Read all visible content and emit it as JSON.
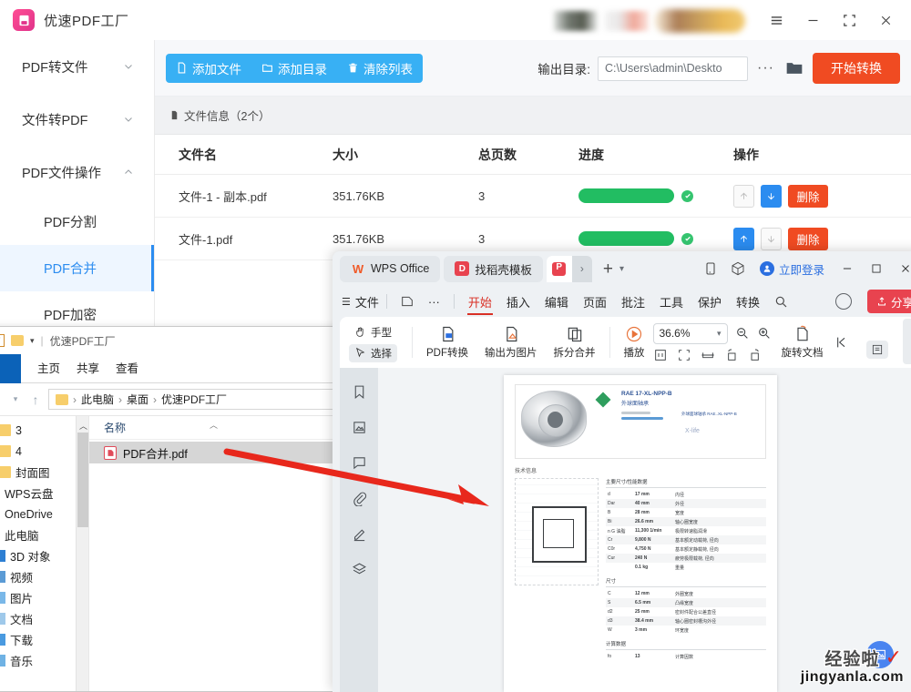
{
  "pdf_factory": {
    "app_title": "优速PDF工厂",
    "window_controls": [
      "menu-icon",
      "minimize-icon",
      "maximize-icon",
      "close-icon"
    ],
    "sidebar": {
      "groups": [
        {
          "label": "PDF转文件",
          "expanded": false
        },
        {
          "label": "文件转PDF",
          "expanded": false
        },
        {
          "label": "PDF文件操作",
          "expanded": true
        }
      ],
      "items": [
        {
          "label": "PDF分割",
          "active": false
        },
        {
          "label": "PDF合并",
          "active": true
        },
        {
          "label": "PDF加密",
          "active": false
        }
      ]
    },
    "toolbar": {
      "add_file": "添加文件",
      "add_folder": "添加目录",
      "clear_list": "清除列表",
      "output_label": "输出目录:",
      "output_path": "C:\\Users\\admin\\Deskto",
      "more_dots": "···",
      "convert_button": "开始转换"
    },
    "info_bar": "文件信息（2个）",
    "table": {
      "headers": [
        "文件名",
        "大小",
        "总页数",
        "进度",
        "操作"
      ],
      "rows": [
        {
          "name": "文件-1 - 副本.pdf",
          "size": "351.76KB",
          "pages": "3",
          "progress": 100,
          "status": "done",
          "up_enabled": false,
          "down_enabled": true,
          "delete_label": "删除"
        },
        {
          "name": "文件-1.pdf",
          "size": "351.76KB",
          "pages": "3",
          "progress": 100,
          "status": "done",
          "up_enabled": true,
          "down_enabled": false,
          "delete_label": "删除"
        }
      ]
    },
    "colors": {
      "accent_blue": "#38b0f4",
      "active_blue": "#2b8cf0",
      "convert_orange": "#f04b22",
      "progress_green": "#22bd62"
    }
  },
  "file_explorer": {
    "title": "优速PDF工厂",
    "ribbon_tabs": [
      "主页",
      "共享",
      "查看"
    ],
    "breadcrumb": [
      "此电脑",
      "桌面",
      "优速PDF工厂"
    ],
    "tree_items": [
      {
        "label": "3"
      },
      {
        "label": "4"
      },
      {
        "label": "封面图"
      },
      {
        "label": "WPS云盘"
      },
      {
        "label": "OneDrive"
      },
      {
        "label": "此电脑"
      },
      {
        "label": "3D 对象"
      },
      {
        "label": "视频"
      },
      {
        "label": "图片"
      },
      {
        "label": "文档"
      },
      {
        "label": "下载"
      },
      {
        "label": "音乐"
      }
    ],
    "column_header": "名称",
    "files": [
      {
        "name": "PDF合并.pdf",
        "selected": true
      }
    ]
  },
  "wps": {
    "tabs": [
      {
        "label": "WPS Office",
        "icon": "wps-logo-icon"
      },
      {
        "label": "找稻壳模板",
        "icon": "docer-icon"
      }
    ],
    "doc_tab": {
      "icon": "pdf-doc-icon",
      "caret": "›"
    },
    "new_tab": "+",
    "titlebar_icons": [
      "tablet-mode-icon",
      "cube-icon"
    ],
    "login_label": "立即登录",
    "window_controls": [
      "minimize-icon",
      "maximize-icon",
      "close-icon"
    ],
    "menu": {
      "file_label": "文件",
      "hamburger": "☰",
      "items": [
        "开始",
        "插入",
        "编辑",
        "页面",
        "批注",
        "工具",
        "保护",
        "转换"
      ],
      "active_item": "开始",
      "search_icon": "search-icon",
      "share_label": "分享"
    },
    "ribbon": {
      "hand_tool": "手型",
      "select_tool": "选择",
      "pdf_convert": "PDF转换",
      "export_image": "输出为图片",
      "split_merge": "拆分合并",
      "play": "播放",
      "zoom_value": "36.6%",
      "rotate_doc": "旋转文档"
    },
    "left_rail_icons": [
      "bookmark-icon",
      "thumbnail-icon",
      "comment-icon",
      "attachment-icon",
      "signature-icon",
      "layers-icon"
    ],
    "document": {
      "title": "RAE 17-XL-NPP-B",
      "subtitle": "外球面轴承",
      "note": "外球面球轴承 RAE..XL-NPP-B",
      "brand": "X-life",
      "section_tech": "技术信息",
      "table_title": "主要尺寸/性能数据",
      "rows": [
        {
          "sym": "d",
          "val": "17 mm",
          "desc": "内径"
        },
        {
          "sym": "Dar",
          "val": "40 mm",
          "desc": "外径"
        },
        {
          "sym": "B",
          "val": "28 mm",
          "desc": "宽度"
        },
        {
          "sym": "Bi",
          "val": "26.6 mm",
          "desc": "轴心圈宽度"
        },
        {
          "sym": "n G 油脂",
          "val": "11,300 1/min",
          "desc": "极限转速脂润滑"
        },
        {
          "sym": "Cr",
          "val": "9,800 N",
          "desc": "基本额定动载荷, 径向"
        },
        {
          "sym": "C0r",
          "val": "4,750 N",
          "desc": "基本额定静载荷, 径向"
        },
        {
          "sym": "Cur",
          "val": "240 N",
          "desc": "疲劳极限载荷, 径向"
        },
        {
          "sym": "",
          "val": "0.1 kg",
          "desc": "重量"
        }
      ],
      "section_dims": "尺寸",
      "dim_rows": [
        {
          "sym": "C",
          "val": "12 mm",
          "desc": "外圈宽度"
        },
        {
          "sym": "S",
          "val": "6.5 mm",
          "desc": "凸缘宽度"
        },
        {
          "sym": "d2",
          "val": "25 mm",
          "desc": "密封件配合公差直径"
        },
        {
          "sym": "d3",
          "val": "38.4 mm",
          "desc": "轴心圈密封槽沟外径"
        },
        {
          "sym": "W",
          "val": "3 mm",
          "desc": "环宽度"
        }
      ],
      "section_calc": "计算数据",
      "calc_rows": [
        {
          "sym": "fo",
          "val": "13",
          "desc": "计算因数"
        }
      ]
    },
    "fab_icon": "export-image-icon"
  },
  "watermark": {
    "cn": "经验啦",
    "en": "jingyanla.com",
    "tick": "✓"
  }
}
